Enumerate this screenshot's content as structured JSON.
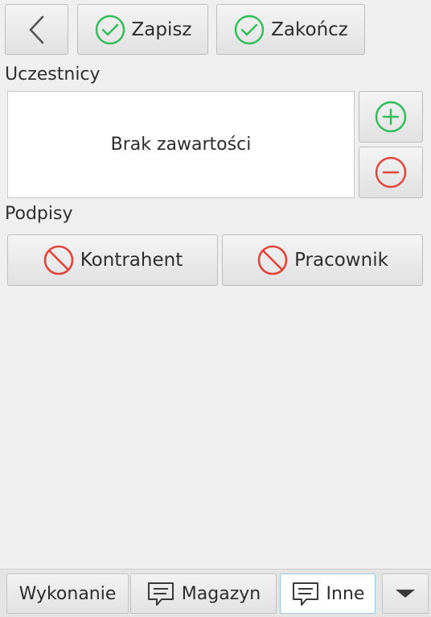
{
  "toolbar": {
    "back_icon": "chevron-left-icon",
    "save_label": "Zapisz",
    "finish_label": "Zakończ",
    "check_icon_color": "#2ebd59"
  },
  "participants": {
    "label": "Uczestnicy",
    "empty_text": "Brak zawartości",
    "add_icon": "plus-circle-icon",
    "remove_icon": "minus-circle-icon",
    "add_color": "#2ebd59",
    "remove_color": "#e0443a"
  },
  "signatures": {
    "label": "Podpisy",
    "contractor_label": "Kontrahent",
    "employee_label": "Pracownik",
    "status_icon": "prohibited-icon",
    "status_color": "#e0443a"
  },
  "bottom_tabs": {
    "execution_label": "Wykonanie",
    "warehouse_label": "Magazyn",
    "other_label": "Inne",
    "active_tab": "Inne",
    "more_icon": "triangle-down-icon"
  }
}
